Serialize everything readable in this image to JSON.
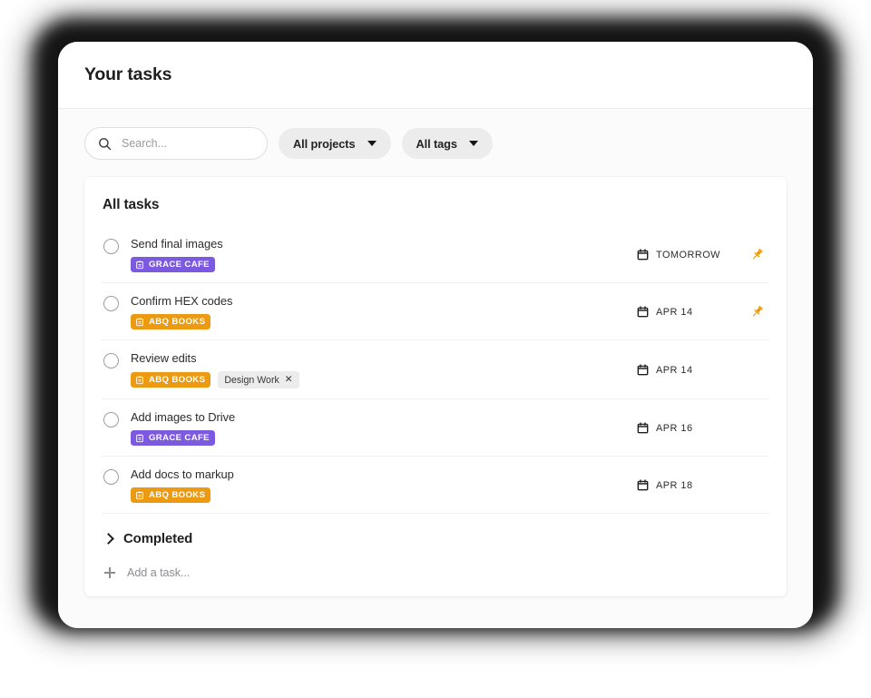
{
  "header": {
    "title": "Your tasks"
  },
  "toolbar": {
    "search": {
      "placeholder": "Search...",
      "value": "",
      "icon": "search-icon"
    },
    "filters": [
      {
        "label": "All projects",
        "icon": "chevron-down-icon"
      },
      {
        "label": "All tags",
        "icon": "chevron-down-icon"
      }
    ]
  },
  "tasks_card": {
    "section_title": "All tasks",
    "tasks": [
      {
        "title": "Send final images",
        "checked": false,
        "project": {
          "label": "GRACE CAFE",
          "color": "#7b5ae0",
          "icon": "clipboard-icon"
        },
        "tags": [],
        "due": "TOMORROW",
        "pinned": true
      },
      {
        "title": "Confirm HEX codes",
        "checked": false,
        "project": {
          "label": "ABQ BOOKS",
          "color": "#eb9a11",
          "icon": "clipboard-icon"
        },
        "tags": [],
        "due": "APR 14",
        "pinned": true
      },
      {
        "title": "Review edits",
        "checked": false,
        "project": {
          "label": "ABQ BOOKS",
          "color": "#eb9a11",
          "icon": "clipboard-icon"
        },
        "tags": [
          {
            "label": "Design Work",
            "removable": true,
            "remove_icon": "close-icon"
          }
        ],
        "due": "APR 14",
        "pinned": false
      },
      {
        "title": "Add images to Drive",
        "checked": false,
        "project": {
          "label": "GRACE CAFE",
          "color": "#7b5ae0",
          "icon": "clipboard-icon"
        },
        "tags": [],
        "due": "APR 16",
        "pinned": false
      },
      {
        "title": "Add docs to markup",
        "checked": false,
        "project": {
          "label": "ABQ BOOKS",
          "color": "#eb9a11",
          "icon": "clipboard-icon"
        },
        "tags": [],
        "due": "APR 18",
        "pinned": false
      }
    ],
    "completed": {
      "label": "Completed",
      "expanded": false,
      "icon": "chevron-right-icon"
    },
    "add_task": {
      "label": "Add a task...",
      "icon": "plus-icon"
    }
  },
  "colors": {
    "project_grace_cafe": "#7b5ae0",
    "project_abq_books": "#eb9a11",
    "pin_accent": "#e8960c",
    "body_background": "#fbfbfc",
    "card_background": "#ffffff",
    "pill_background": "#ececed"
  }
}
